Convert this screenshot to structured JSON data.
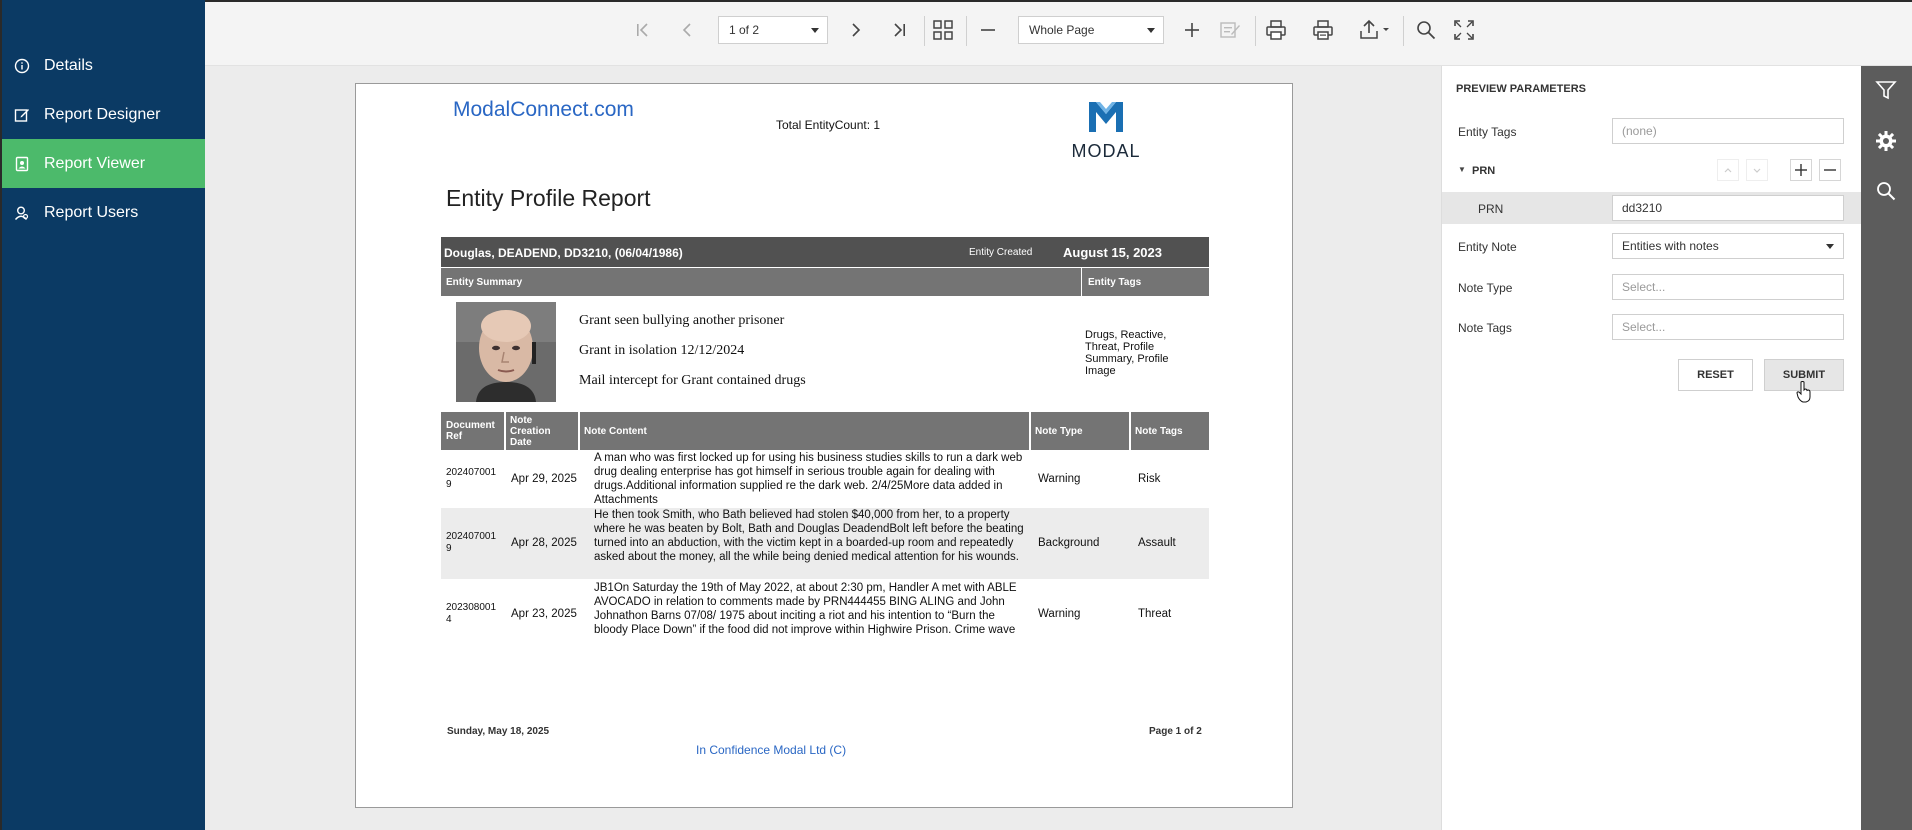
{
  "sidebar": {
    "items": [
      {
        "label": "Details",
        "icon": "info-icon"
      },
      {
        "label": "Report Designer",
        "icon": "edit-icon"
      },
      {
        "label": "Report Viewer",
        "icon": "report-icon",
        "active": true
      },
      {
        "label": "Report Users",
        "icon": "user-icon"
      }
    ]
  },
  "toolbar": {
    "page_select": "1 of 2",
    "zoom_select": "Whole Page"
  },
  "report": {
    "brand": "ModalConnect.com",
    "total_count": "Total EntityCount: 1",
    "logo_text": "MODAL",
    "title": "Entity Profile Report",
    "entity_name": "Douglas, DEADEND, DD3210, (06/04/1986)",
    "entity_created_label": "Entity Created",
    "entity_created_value": "August 15, 2023",
    "summary_header": "Entity Summary",
    "tags_header": "Entity Tags",
    "summary_lines": [
      "Grant seen bullying another prisoner",
      "Grant in isolation 12/12/2024",
      "Mail intercept for Grant contained drugs"
    ],
    "entity_tags": "Drugs, Reactive, Threat, Profile Summary, Profile Image",
    "notes_headers": {
      "doc_ref": "Document Ref",
      "date": "Note Creation Date",
      "content": "Note Content",
      "type": "Note Type",
      "tags": "Note Tags"
    },
    "notes": [
      {
        "ref": "2024070019",
        "date": "Apr 29, 2025",
        "content": "A man who was first locked up for using his business studies skills to run a dark web drug dealing enterprise has got himself in serious trouble again for dealing with drugs.Additional information supplied re the dark web. 2/4/25More data added in Attachments",
        "type": "Warning",
        "tags": "Risk"
      },
      {
        "ref": "2024070019",
        "date": "Apr 28, 2025",
        "content": "He then took Smith, who Bath believed had stolen $40,000 from her, to a property where he was beaten by Bolt, Bath and Douglas DeadendBolt left before the beating turned into an abduction, with the victim kept in a boarded-up room and repeatedly asked about the money, all the while being denied medical attention for his wounds.",
        "type": "Background",
        "tags": "Assault"
      },
      {
        "ref": "2023080014",
        "date": "Apr 23, 2025",
        "content": "JB1On Saturday the 19th of May 2022, at about 2:30 pm, Handler A met with ABLE AVOCADO in relation to comments made by PRN444455 BING ALING and John Johnathon Barns 07/08/ 1975 about inciting a riot and his intention to “Burn the bloody Place Down” if the food did not improve within Highwire Prison. Crime wave",
        "type": "Warning",
        "tags": "Threat"
      }
    ],
    "footer_date": "Sunday, May 18, 2025",
    "footer_page": "Page 1 of 2",
    "footer_conf": "In Confidence  Modal Ltd (C)"
  },
  "params": {
    "title": "PREVIEW PARAMETERS",
    "entity_tags_label": "Entity Tags",
    "entity_tags_value": "(none)",
    "prn_group_label": "PRN",
    "prn_label": "PRN",
    "prn_value": "dd3210",
    "entity_note_label": "Entity Note",
    "entity_note_value": "Entities with notes",
    "note_type_label": "Note Type",
    "note_type_placeholder": "Select...",
    "note_tags_label": "Note Tags",
    "note_tags_placeholder": "Select...",
    "reset_label": "RESET",
    "submit_label": "SUBMIT"
  },
  "colors": {
    "sidebar_bg": "#0b3a64",
    "active_item": "#4cba6b",
    "link_blue": "#2a67c4",
    "header_dark": "#515151",
    "header_mid": "#747474",
    "rail_bg": "#5c5c5c"
  }
}
